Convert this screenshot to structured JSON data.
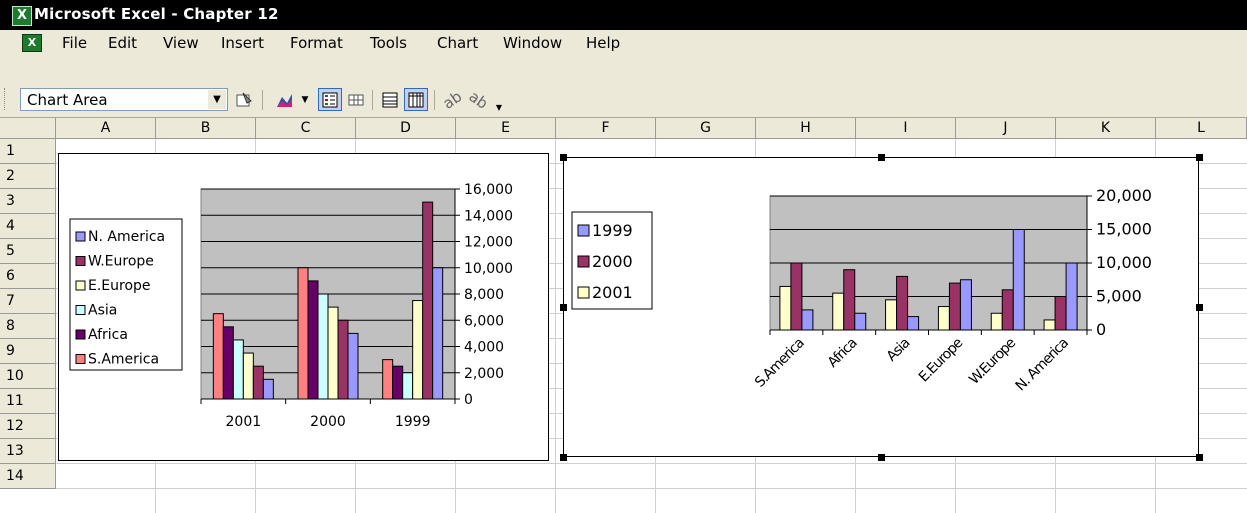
{
  "app": {
    "icon_letter": "X",
    "window_title": "Microsoft Excel - Chapter 12"
  },
  "menu": {
    "doc_icon_letter": "X",
    "items": [
      {
        "label": "File"
      },
      {
        "label": "Edit"
      },
      {
        "label": "View"
      },
      {
        "label": "Insert"
      },
      {
        "label": "Format"
      },
      {
        "label": "Tools"
      },
      {
        "label": "Chart"
      },
      {
        "label": "Window"
      },
      {
        "label": "Help"
      }
    ]
  },
  "toolbar": {
    "name_box_value": "Chart Area",
    "buttons": [
      "format-selected-object-icon",
      "chart-type-icon",
      "legend-icon",
      "data-table-icon",
      "by-row-icon",
      "by-column-icon",
      "angle-clockwise-icon",
      "angle-counterclockwise-icon"
    ]
  },
  "sheet": {
    "columns": [
      "A",
      "B",
      "C",
      "D",
      "E",
      "F",
      "G",
      "H",
      "I",
      "J",
      "K",
      "L"
    ],
    "rows": [
      "1",
      "2",
      "3",
      "4",
      "5",
      "6",
      "7",
      "8",
      "9",
      "10",
      "11",
      "12",
      "13",
      "14"
    ]
  },
  "chart_data": [
    {
      "type": "bar",
      "title": "",
      "categories": [
        "2001",
        "2000",
        "1999"
      ],
      "series": [
        {
          "name": "N. America",
          "color": "#9999ff",
          "values": [
            1500,
            5000,
            10000
          ]
        },
        {
          "name": "W.Europe",
          "color": "#993366",
          "values": [
            2500,
            6000,
            15000
          ]
        },
        {
          "name": "E.Europe",
          "color": "#ffffcc",
          "values": [
            3500,
            7000,
            7500
          ]
        },
        {
          "name": "Asia",
          "color": "#ccffff",
          "values": [
            4500,
            8000,
            2000
          ]
        },
        {
          "name": "Africa",
          "color": "#660066",
          "values": [
            5500,
            9000,
            2500
          ]
        },
        {
          "name": "S.America",
          "color": "#ff8080",
          "values": [
            6500,
            10000,
            3000
          ]
        }
      ],
      "series_draw_order": [
        "S.America",
        "Africa",
        "Asia",
        "E.Europe",
        "W.Europe",
        "N. America"
      ],
      "ylim": [
        0,
        16000
      ],
      "yticks": [
        "0",
        "2,000",
        "4,000",
        "6,000",
        "8,000",
        "10,000",
        "12,000",
        "14,000",
        "16,000"
      ],
      "y_axis_side": "right",
      "plot_background": "#c0c0c0",
      "grid": true,
      "legend_position": "left"
    },
    {
      "type": "bar",
      "title": "",
      "categories": [
        "S.America",
        "Africa",
        "Asia",
        "E.Europe",
        "W.Europe",
        "N. America"
      ],
      "series": [
        {
          "name": "2001",
          "color": "#ffffcc",
          "values": [
            6500,
            5500,
            4500,
            3500,
            2500,
            1500
          ]
        },
        {
          "name": "2000",
          "color": "#993366",
          "values": [
            10000,
            9000,
            8000,
            7000,
            6000,
            5000
          ]
        },
        {
          "name": "1999",
          "color": "#9999ff",
          "values": [
            3000,
            2500,
            2000,
            7500,
            15000,
            10000
          ]
        }
      ],
      "series_draw_order": [
        "2001",
        "2000",
        "1999"
      ],
      "ylim": [
        0,
        20000
      ],
      "yticks": [
        "0",
        "5,000",
        "10,000",
        "15,000",
        "20,000"
      ],
      "y_axis_side": "right",
      "x_label_rotation": "-45",
      "plot_background": "#c0c0c0",
      "grid": true,
      "legend_order": [
        "1999",
        "2000",
        "2001"
      ],
      "legend_position": "left",
      "selected": true
    }
  ]
}
